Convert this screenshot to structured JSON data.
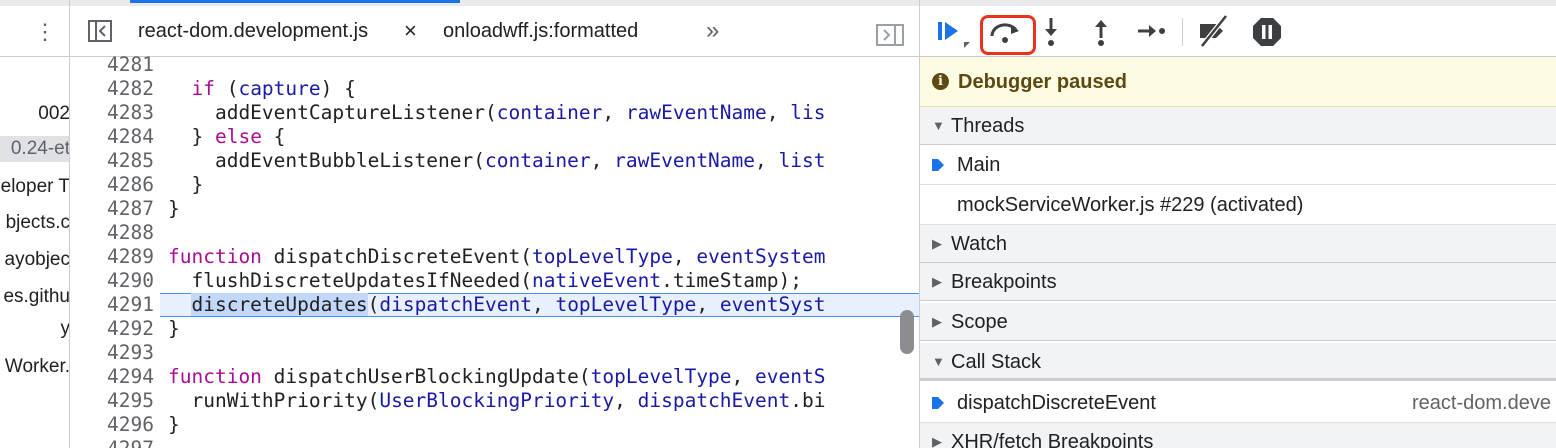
{
  "navigator": {
    "items": [
      "002",
      "0.24-et",
      "eloper T",
      "bjects.c",
      "ayobjec",
      "es.githu",
      "y",
      "Worker."
    ],
    "selected_index": 1
  },
  "editor": {
    "tabs": {
      "active": "react-dom.development.js",
      "close": "×",
      "second": "onloadwff.js:formatted",
      "more": "»"
    },
    "lines": [
      {
        "n": "4281",
        "text": ""
      },
      {
        "n": "4282",
        "text": "  if (capture) {"
      },
      {
        "n": "4283",
        "text": "    addEventCaptureListener(container, rawEventName, lis"
      },
      {
        "n": "4284",
        "text": "  } else {"
      },
      {
        "n": "4285",
        "text": "    addEventBubbleListener(container, rawEventName, list"
      },
      {
        "n": "4286",
        "text": "  }"
      },
      {
        "n": "4287",
        "text": "}"
      },
      {
        "n": "4288",
        "text": ""
      },
      {
        "n": "4289",
        "text": "function dispatchDiscreteEvent(topLevelType, eventSystem"
      },
      {
        "n": "4290",
        "text": "  flushDiscreteUpdatesIfNeeded(nativeEvent.timeStamp);"
      },
      {
        "n": "4291",
        "text": "  discreteUpdates(dispatchEvent, topLevelType, eventSyst"
      },
      {
        "n": "4292",
        "text": "}"
      },
      {
        "n": "4293",
        "text": ""
      },
      {
        "n": "4294",
        "text": "function dispatchUserBlockingUpdate(topLevelType, eventS"
      },
      {
        "n": "4295",
        "text": "  runWithPriority(UserBlockingPriority, dispatchEvent.bi"
      },
      {
        "n": "4296",
        "text": "}"
      },
      {
        "n": "4297",
        "text": ""
      }
    ],
    "paused_line": "4291"
  },
  "debugger": {
    "toolbar": {
      "resume": "resume-icon",
      "step_over": "step-over-icon",
      "step_into": "step-into-icon",
      "step_out": "step-out-icon",
      "step": "step-icon",
      "deactivate": "deactivate-breakpoints-icon",
      "pause_exceptions": "pause-on-exceptions-icon"
    },
    "paused_text": "Debugger paused",
    "threads_label": "Threads",
    "threads": [
      "Main",
      "mockServiceWorker.js #229 (activated)"
    ],
    "watch_label": "Watch",
    "breakpoints_label": "Breakpoints",
    "scope_label": "Scope",
    "call_stack_label": "Call Stack",
    "call_stack": [
      {
        "name": "dispatchDiscreteEvent",
        "location": "react-dom.deve"
      }
    ],
    "xhr_label": "XHR/fetch Breakpoints",
    "colors": {
      "accent": "#1a73e8",
      "highlight_box": "#e8331e",
      "banner": "#fefbe3"
    }
  }
}
